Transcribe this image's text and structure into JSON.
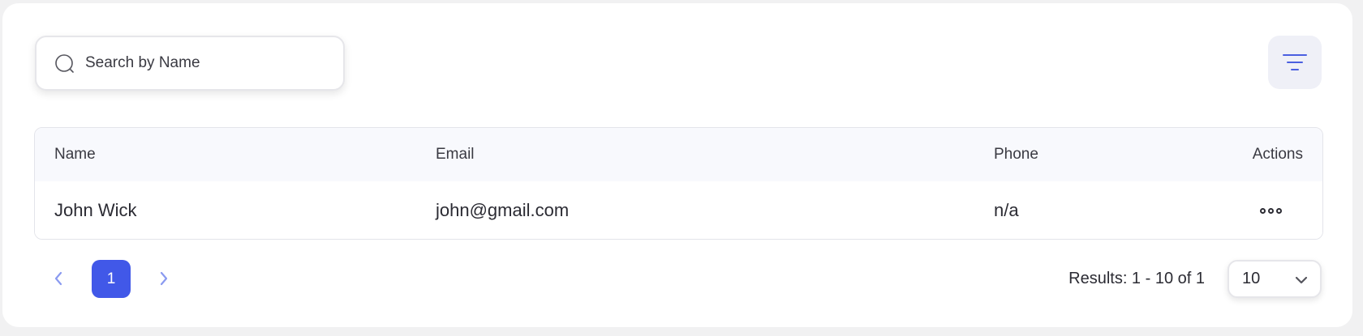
{
  "search": {
    "placeholder": "Search by Name",
    "value": ""
  },
  "table": {
    "columns": [
      "Name",
      "Email",
      "Phone",
      "Actions"
    ],
    "rows": [
      {
        "name": "John Wick",
        "email": "john@gmail.com",
        "phone": "n/a"
      }
    ]
  },
  "pagination": {
    "current_page": "1",
    "results_text": "Results: 1 - 10 of 1",
    "per_page": "10"
  },
  "colors": {
    "accent": "#4158e8",
    "filter_icon": "#4a5fe0",
    "header_bg": "#f8f9fd",
    "page_bg": "#f1f1f2"
  },
  "icons": {
    "search": "search-icon",
    "filter": "filter-icon",
    "more": "more-horizontal-icon",
    "prev": "chevron-left-icon",
    "next": "chevron-right-icon",
    "dropdown": "chevron-down-icon"
  }
}
